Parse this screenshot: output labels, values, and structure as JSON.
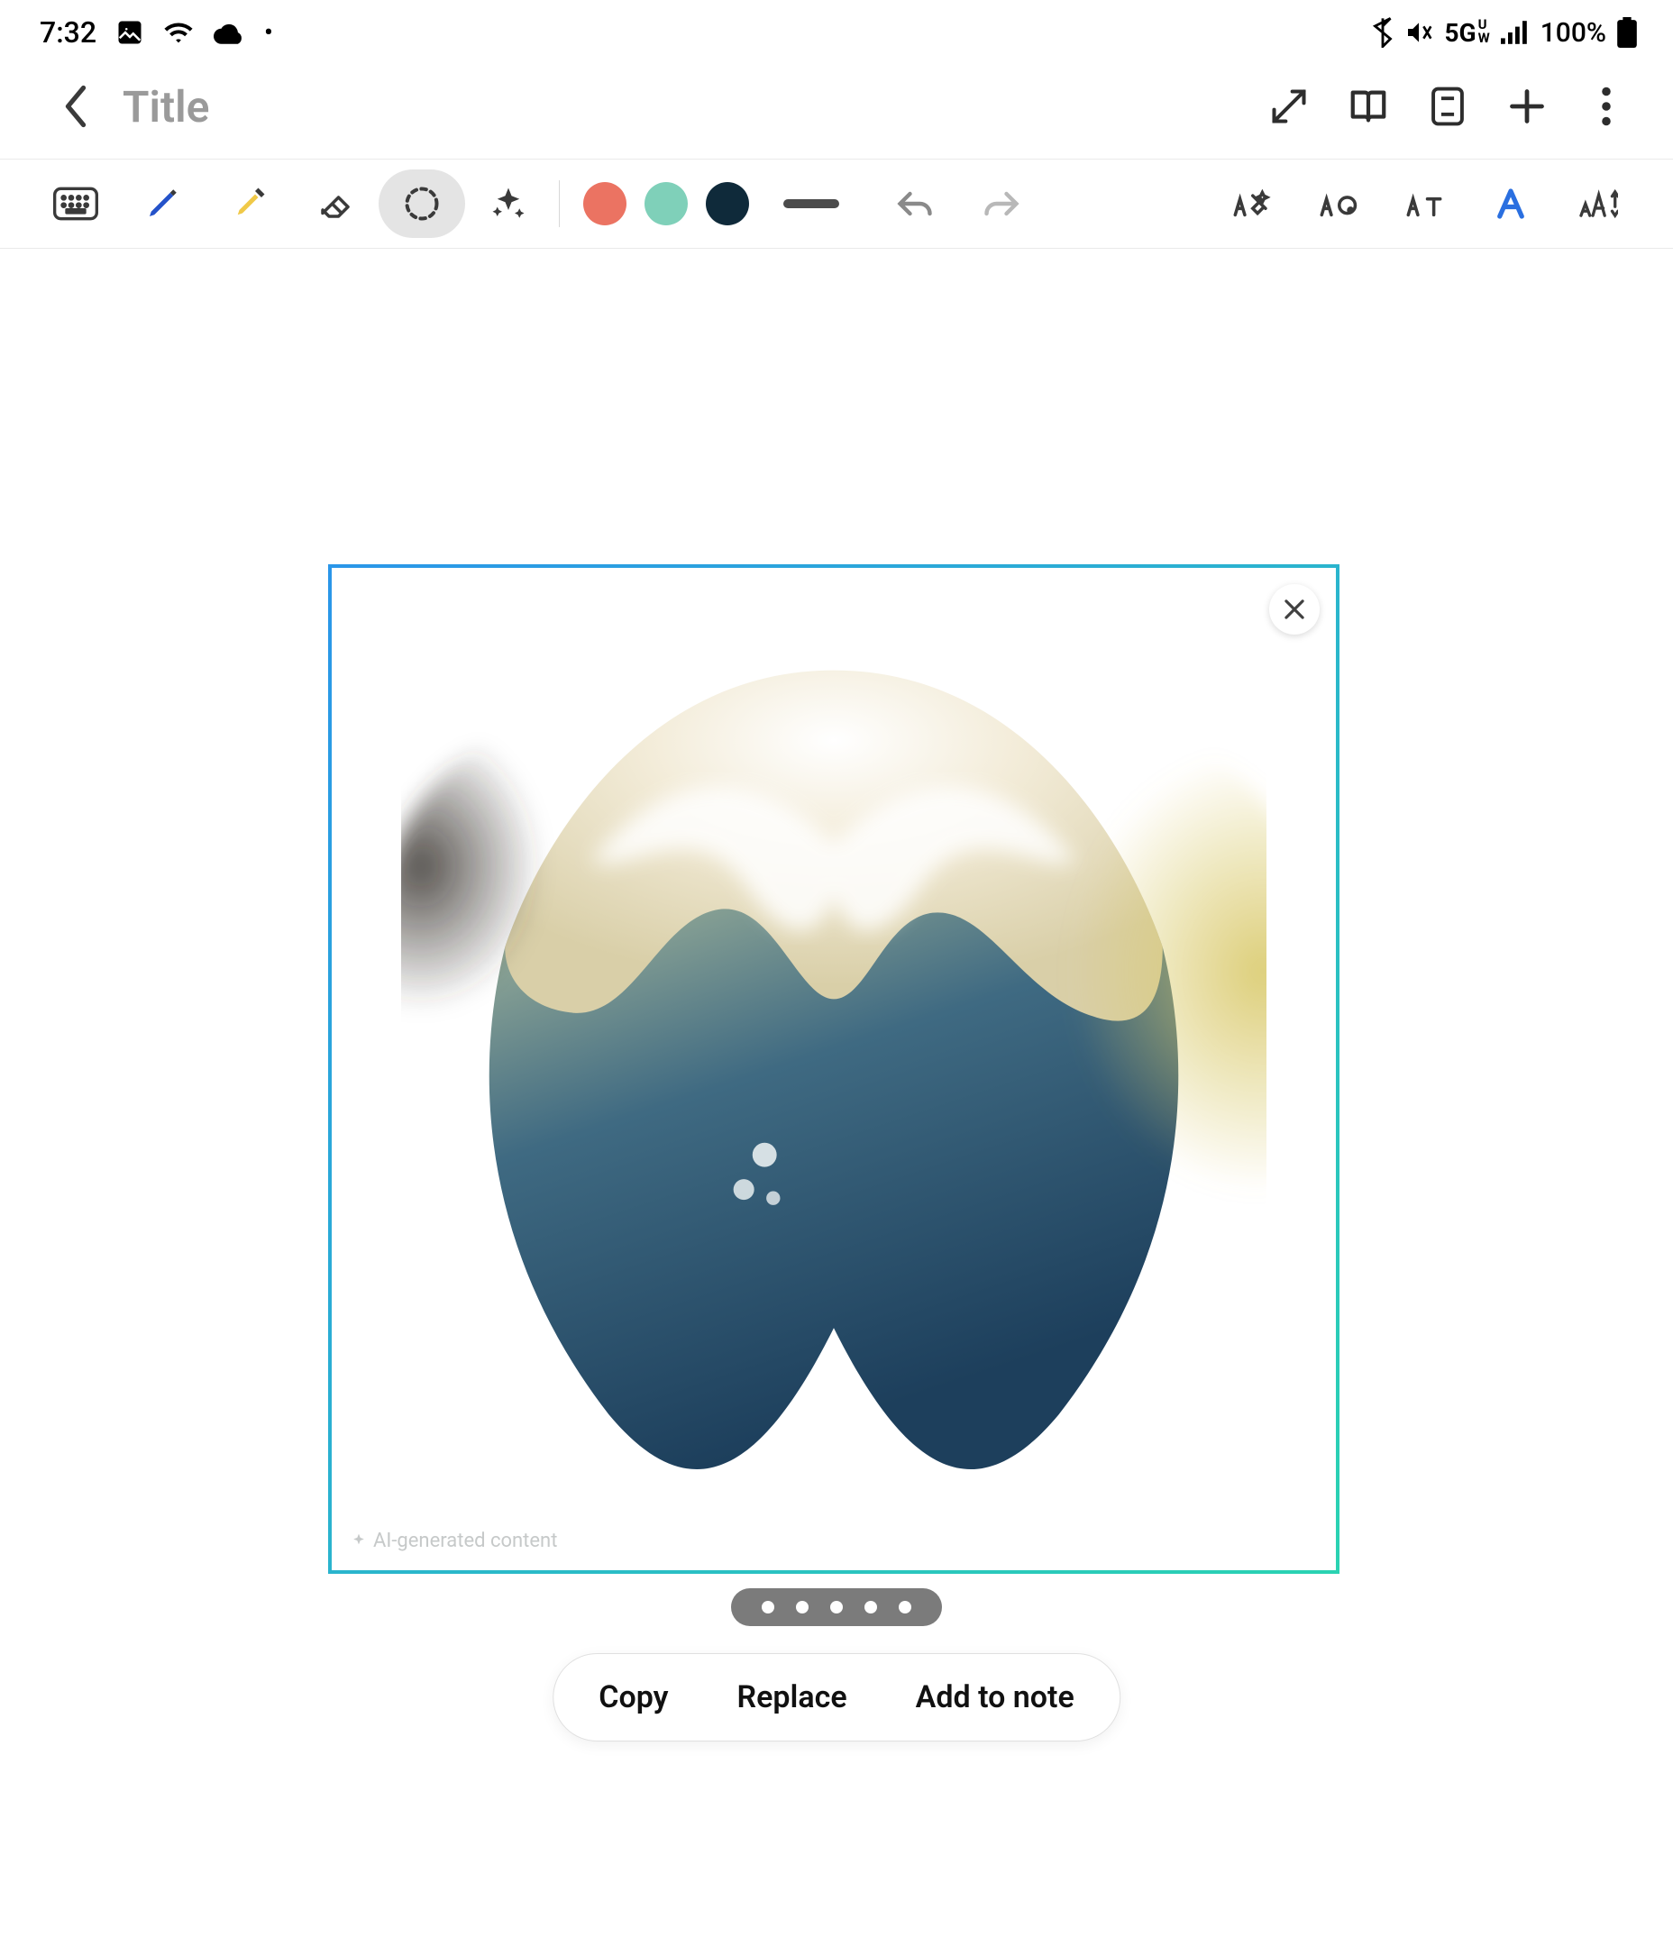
{
  "status": {
    "time": "7:32",
    "network_label": "5G",
    "network_sub": "U",
    "network_sub2": "W",
    "battery_pct": "100%"
  },
  "header": {
    "title_placeholder": "Title"
  },
  "toolbar": {
    "colors": {
      "c1": "#eb7362",
      "c2": "#7fd0b9",
      "c3": "#0f2a3a"
    }
  },
  "image": {
    "watermark": "AI-generated content"
  },
  "actions": {
    "copy": "Copy",
    "replace": "Replace",
    "add": "Add to note"
  }
}
